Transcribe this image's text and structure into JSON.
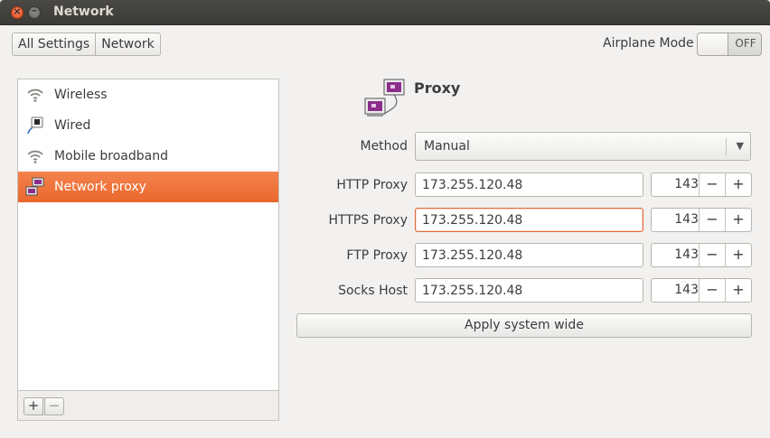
{
  "window": {
    "title": "Network"
  },
  "breadcrumb": {
    "all_settings": "All Settings",
    "current": "Network"
  },
  "airplane": {
    "label": "Airplane Mode",
    "state": "OFF"
  },
  "sidebar": {
    "items": [
      {
        "label": "Wireless",
        "icon": "wifi-icon"
      },
      {
        "label": "Wired",
        "icon": "wired-icon"
      },
      {
        "label": "Mobile broadband",
        "icon": "wifi-icon"
      },
      {
        "label": "Network proxy",
        "icon": "network-proxy-icon"
      }
    ],
    "add_label": "+",
    "remove_label": "−"
  },
  "proxy": {
    "title": "Proxy",
    "method_label": "Method",
    "method_value": "Manual",
    "rows": [
      {
        "label": "HTTP Proxy",
        "host": "173.255.120.48",
        "port": "143"
      },
      {
        "label": "HTTPS Proxy",
        "host": "173.255.120.48",
        "port": "143"
      },
      {
        "label": "FTP Proxy",
        "host": "173.255.120.48",
        "port": "143"
      },
      {
        "label": "Socks Host",
        "host": "173.255.120.48",
        "port": "143"
      }
    ],
    "minus": "−",
    "plus": "+",
    "apply_label": "Apply system wide"
  },
  "colors": {
    "accent": "#e9672c",
    "selection_start": "#f4834e",
    "icon_purple": "#8b2d8a"
  }
}
